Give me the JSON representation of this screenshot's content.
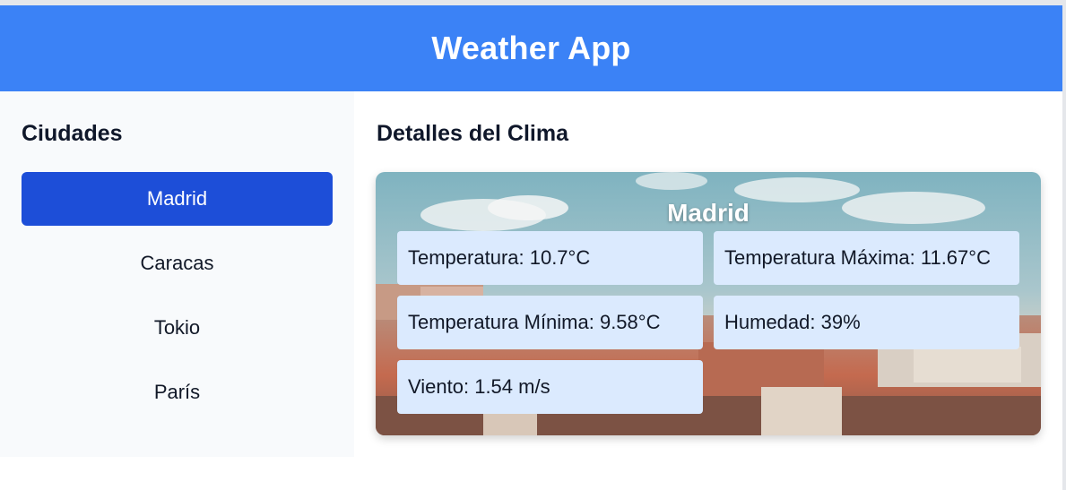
{
  "header": {
    "title": "Weather App"
  },
  "sidebar": {
    "title": "Ciudades",
    "cities": [
      "Madrid",
      "Caracas",
      "Tokio",
      "París"
    ],
    "selected": "Madrid"
  },
  "main": {
    "title": "Detalles del Clima",
    "card": {
      "city": "Madrid",
      "temperature": "Temperatura: 10.7°C",
      "temp_max": "Temperatura Máxima: 11.67°C",
      "temp_min": "Temperatura Mínima: 9.58°C",
      "humidity": "Humedad: 39%",
      "wind": "Viento: 1.54 m/s"
    }
  },
  "colors": {
    "header": "#3b82f6",
    "active_city": "#1d4ed8",
    "stat_box": "#dbeafe",
    "sidebar_bg": "#f8fafc"
  }
}
